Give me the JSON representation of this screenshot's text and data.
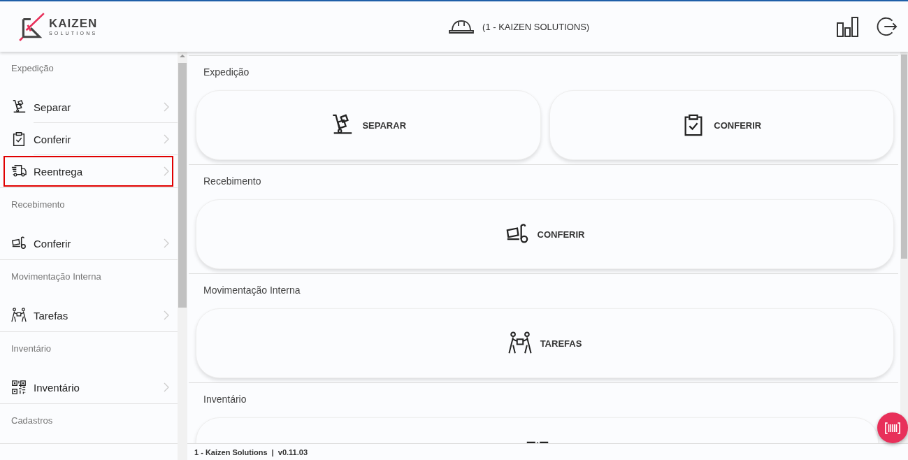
{
  "header": {
    "logo": {
      "name": "KAIZEN",
      "tagline": "SOLUTIONS"
    },
    "company": "(1 - KAIZEN SOLUTIONS)"
  },
  "sidebar": {
    "sections": [
      {
        "title": "Expedição",
        "items": [
          {
            "label": "Separar",
            "kind": "handtruck",
            "highlighted": false
          },
          {
            "label": "Conferir",
            "kind": "clipboard",
            "highlighted": false
          },
          {
            "label": "Reentrega",
            "kind": "truck",
            "highlighted": true
          }
        ]
      },
      {
        "title": "Recebimento",
        "items": [
          {
            "label": "Conferir",
            "kind": "cart",
            "highlighted": false
          }
        ]
      },
      {
        "title": "Movimentação Interna",
        "items": [
          {
            "label": "Tarefas",
            "kind": "people",
            "highlighted": false
          }
        ]
      },
      {
        "title": "Inventário",
        "items": [
          {
            "label": "Inventário",
            "kind": "qr",
            "highlighted": false
          }
        ]
      },
      {
        "title": "Cadastros"
      }
    ]
  },
  "main": {
    "sections": [
      {
        "title": "Expedição",
        "cards": [
          {
            "label": "SEPARAR",
            "kind": "handtruck"
          },
          {
            "label": "CONFERIR",
            "kind": "clipboard"
          }
        ]
      },
      {
        "title": "Recebimento",
        "cards": [
          {
            "label": "CONFERIR",
            "kind": "cart"
          }
        ]
      },
      {
        "title": "Movimentação Interna",
        "cards": [
          {
            "label": "TAREFAS",
            "kind": "people"
          }
        ]
      },
      {
        "title": "Inventário",
        "cards": [
          {
            "kind": "qr"
          }
        ]
      }
    ]
  },
  "footer": {
    "company": "1 - Kaizen Solutions",
    "separator": "|",
    "version": "v0.11.03"
  }
}
